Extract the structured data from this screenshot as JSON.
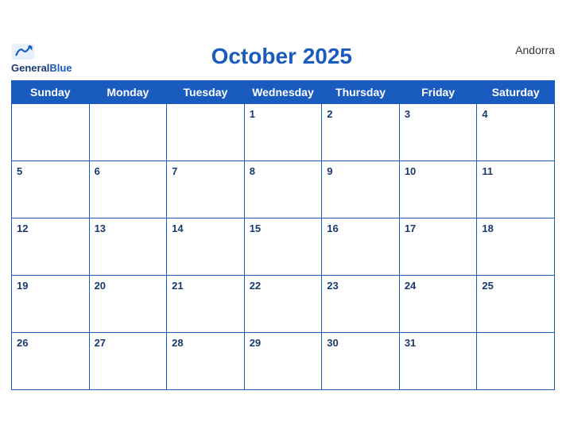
{
  "header": {
    "title": "October 2025",
    "country": "Andorra",
    "logo_line1": "General",
    "logo_line2": "Blue"
  },
  "weekdays": [
    "Sunday",
    "Monday",
    "Tuesday",
    "Wednesday",
    "Thursday",
    "Friday",
    "Saturday"
  ],
  "weeks": [
    [
      null,
      null,
      null,
      1,
      2,
      3,
      4
    ],
    [
      5,
      6,
      7,
      8,
      9,
      10,
      11
    ],
    [
      12,
      13,
      14,
      15,
      16,
      17,
      18
    ],
    [
      19,
      20,
      21,
      22,
      23,
      24,
      25
    ],
    [
      26,
      27,
      28,
      29,
      30,
      31,
      null
    ]
  ],
  "colors": {
    "header_bg": "#1a5bbf",
    "border": "#1a5bbf",
    "title": "#1a5bbf",
    "day_number": "#1a3a6e"
  }
}
